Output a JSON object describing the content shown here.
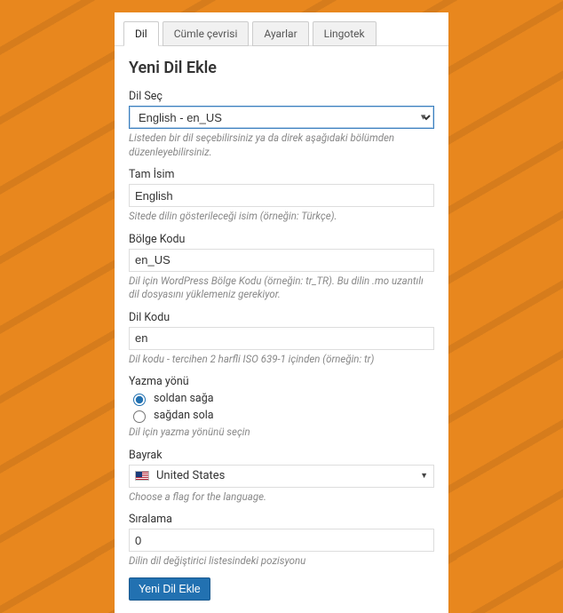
{
  "tabs": {
    "dil": "Dil",
    "cumle": "Cümle çevrisi",
    "ayarlar": "Ayarlar",
    "lingotek": "Lingotek"
  },
  "title": "Yeni Dil Ekle",
  "dil_sec": {
    "label": "Dil Seç",
    "value": "English - en_US",
    "help": "Listeden bir dil seçebilirsiniz ya da direk aşağıdaki bölümden düzenleyebilirsiniz."
  },
  "tam_isim": {
    "label": "Tam İsim",
    "value": "English",
    "help": "Sitede dilin gösterileceği isim (örneğin: Türkçe)."
  },
  "bolge_kodu": {
    "label": "Bölge Kodu",
    "value": "en_US",
    "help": "Dil için WordPress Bölge Kodu (örneğin: tr_TR). Bu dilin .mo uzantılı dil dosyasını yüklemeniz gerekiyor."
  },
  "dil_kodu": {
    "label": "Dil Kodu",
    "value": "en",
    "help": "Dil kodu - tercihen 2 harfli ISO 639-1 içinden (örneğin: tr)"
  },
  "yazma": {
    "label": "Yazma yönü",
    "ltr": "soldan sağa",
    "rtl": "sağdan sola",
    "help": "Dil için yazma yönünü seçin"
  },
  "bayrak": {
    "label": "Bayrak",
    "value": "United States",
    "help": "Choose a flag for the language."
  },
  "siralama": {
    "label": "Sıralama",
    "value": "0",
    "help": "Dilin dil değiştirici listesindeki pozisyonu"
  },
  "submit": "Yeni Dil Ekle"
}
